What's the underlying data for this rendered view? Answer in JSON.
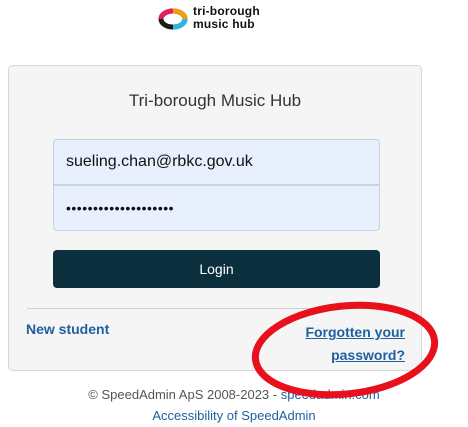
{
  "logo": {
    "line1": "tri-borough",
    "line2": "music hub"
  },
  "login": {
    "title": "Tri-borough Music Hub",
    "email_value": "sueling.chan@rbkc.gov.uk",
    "password_value": "••••••••••••••••••••",
    "button_label": "Login",
    "new_student_label": "New student",
    "forgot_label": "Forgotten your password?"
  },
  "footer": {
    "copyright_text": "© SpeedAdmin ApS 2008-2023 - ",
    "site_link": "speedadmin.com",
    "accessibility_link": "Accessibility of SpeedAdmin"
  },
  "colors": {
    "button": "#0c2f3d",
    "link": "#1f5fa0",
    "annotation": "#e8101a"
  }
}
